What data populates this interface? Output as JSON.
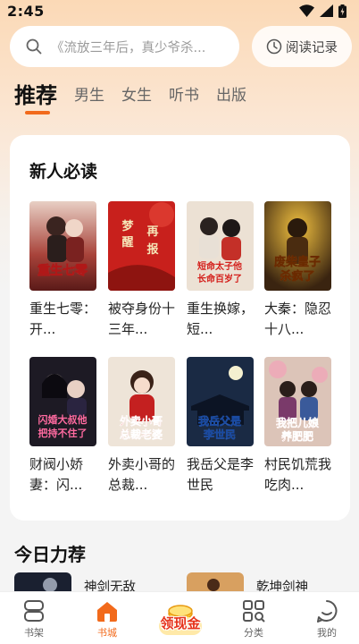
{
  "status_bar": {
    "time": "2:45"
  },
  "search": {
    "placeholder": "《流放三年后，真少爷杀..."
  },
  "history_button": {
    "label": "阅读记录"
  },
  "tabs": [
    {
      "label": "推荐",
      "active": true
    },
    {
      "label": "男生",
      "active": false
    },
    {
      "label": "女生",
      "active": false
    },
    {
      "label": "听书",
      "active": false
    },
    {
      "label": "出版",
      "active": false
    }
  ],
  "new_reader": {
    "title": "新人必读",
    "books": [
      {
        "title": "重生七零：开...",
        "cover_text": "重生七零",
        "cover_color": "#b8433a"
      },
      {
        "title": "被夺身份十三年...",
        "cover_text": "梦醒再报",
        "cover_color": "#c8201c"
      },
      {
        "title": "重生换嫁，短...",
        "cover_text": "短命太子他长命百岁了",
        "cover_color": "#e9dccf"
      },
      {
        "title": "大秦：隐忍十八...",
        "cover_text": "废柴皇子杀疯了",
        "cover_color": "#3a2a12"
      },
      {
        "title": "财阀小娇妻：闪...",
        "cover_text": "闪婚大叔他把持不住了",
        "cover_color": "#1d1a24"
      },
      {
        "title": "外卖小哥的总裁...",
        "cover_text": "外卖小哥总裁老婆",
        "cover_color": "#e8ddd0"
      },
      {
        "title": "我岳父是李世民",
        "cover_text": "我岳父是李世民",
        "cover_color": "#1a2a44"
      },
      {
        "title": "村民饥荒我吃肉...",
        "cover_text": "我把儿娘养肥肥",
        "cover_color": "#d9c0b4"
      }
    ]
  },
  "today": {
    "title": "今日力荐",
    "items": [
      {
        "name": "神剑无敌"
      },
      {
        "name": "乾坤剑神"
      }
    ]
  },
  "bottom_nav": {
    "items": [
      {
        "label": "书架",
        "icon": "bookshelf-icon"
      },
      {
        "label": "书城",
        "icon": "home-icon",
        "active": true
      },
      {
        "label": "分类",
        "icon": "category-icon"
      },
      {
        "label": "我的",
        "icon": "profile-icon"
      }
    ],
    "cash_label": "领现金"
  },
  "colors": {
    "accent": "#f26a1b",
    "cash": "#e6331a"
  }
}
